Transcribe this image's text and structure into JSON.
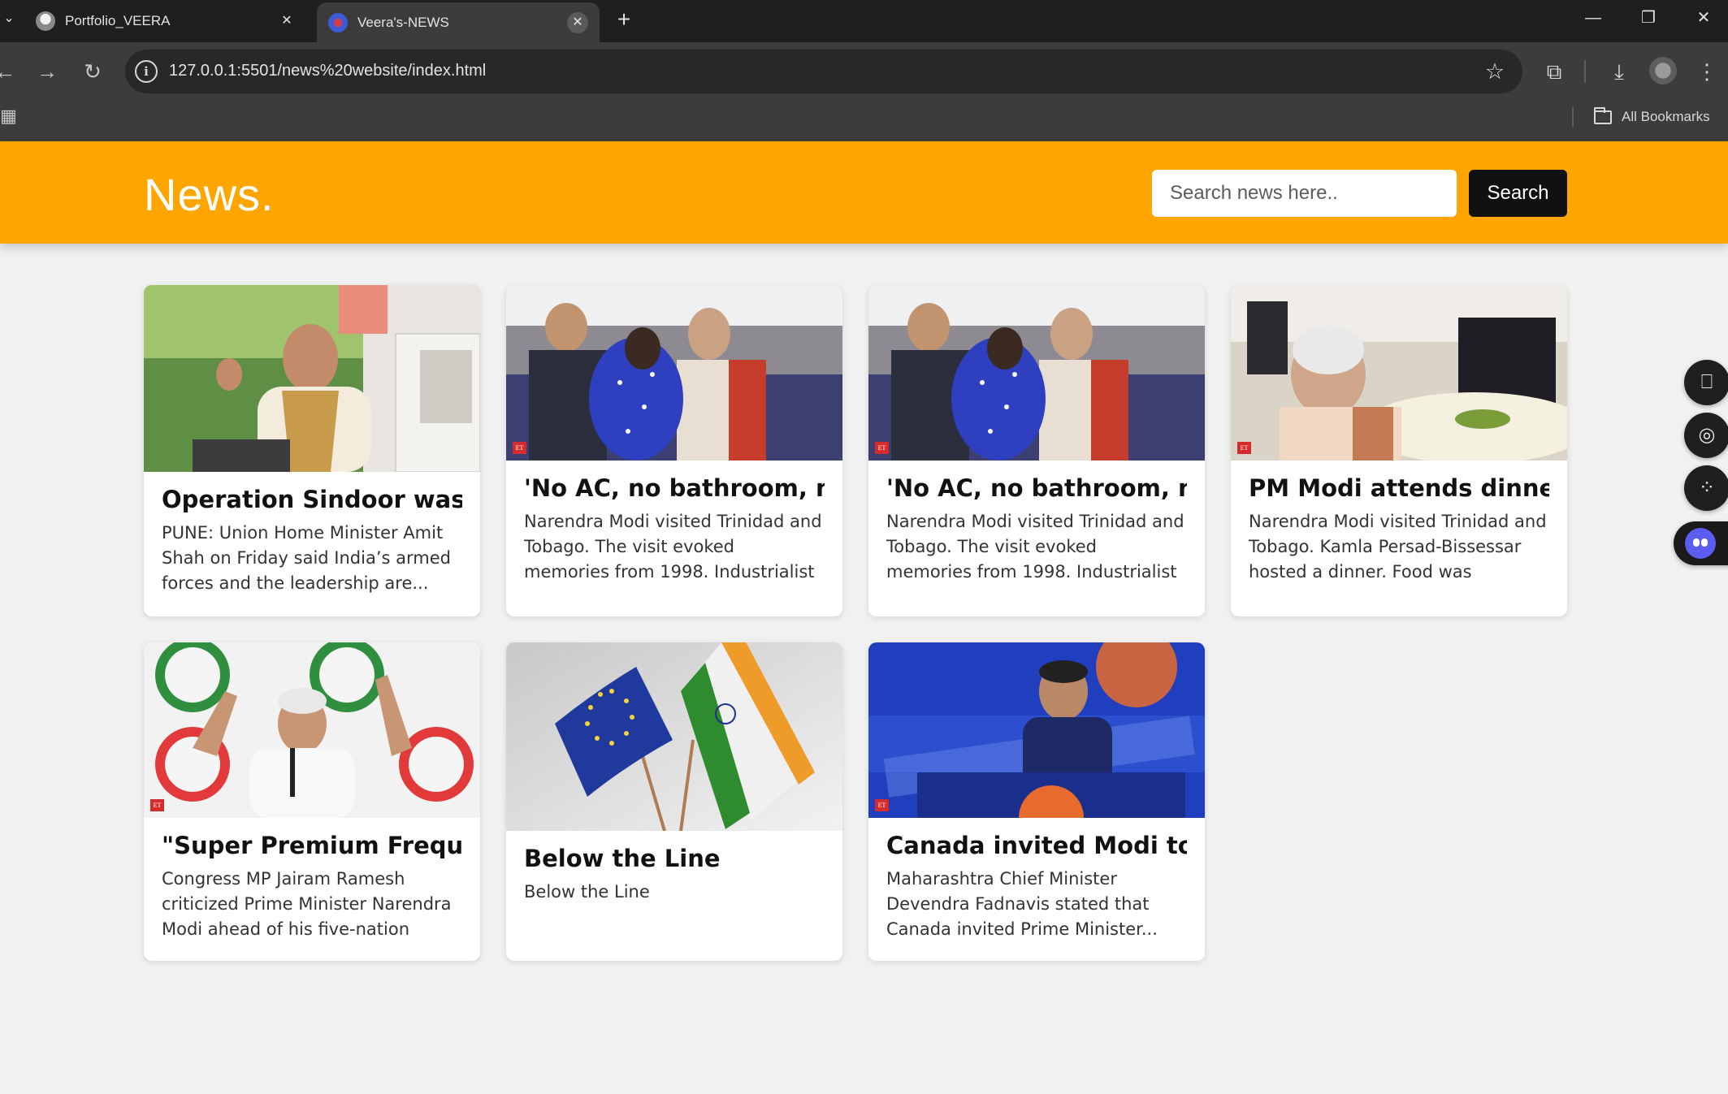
{
  "browser": {
    "tabs": [
      {
        "title": "Portfolio_VEERA",
        "close": "✕"
      },
      {
        "title": "Veera's-NEWS",
        "close": "✕"
      }
    ],
    "new_tab": "+",
    "window_controls": {
      "minimize": "—",
      "restore": "❐",
      "close": "✕"
    },
    "nav": {
      "back": "←",
      "forward": "→",
      "reload": "↻"
    },
    "url": "127.0.0.1:5501/news%20website/index.html",
    "bookmarks": {
      "all_bookmarks": "All Bookmarks"
    }
  },
  "header": {
    "logo": "News.",
    "search_placeholder": "Search news here..",
    "search_button": "Search"
  },
  "cards": [
    {
      "title": "Operation Sindoor was ‘f...",
      "description": "PUNE: Union Home Minister Amit Shah on Friday said India’s armed forces and the leadership are...",
      "image": "Amit Shah speaking at podium"
    },
    {
      "title": "'No AC, no bathroom, no...",
      "description": "Narendra Modi visited Trinidad and Tobago. The visit evoked memories from 1998. Industrialist ML Mittal...",
      "image": "Narendra Modi greeting woman in blue saree"
    },
    {
      "title": "'No AC, no bathroom, no...",
      "description": "Narendra Modi visited Trinidad and Tobago. The visit evoked memories from 1998. Industrialist ML Mittal...",
      "image": "Narendra Modi greeting woman in blue saree"
    },
    {
      "title": "PM Modi attends dinner ...",
      "description": "Narendra Modi visited Trinidad and Tobago. Kamla Persad-Bissessar hosted a dinner. Food was served...",
      "image": "Narendra Modi at dinner table"
    },
    {
      "title": "\"Super Premium Frequen...",
      "description": "Congress MP Jairam Ramesh criticized Prime Minister Narendra Modi ahead of his five-nation tour,...",
      "image": "Jairam Ramesh gesturing in front of Congress symbols"
    },
    {
      "title": "Below the Line",
      "description": "Below the Line",
      "image": "EU and India flags"
    },
    {
      "title": "Canada invited Modi to ...",
      "description": "Maharashtra Chief Minister Devendra Fadnavis stated that Canada invited Prime Minister...",
      "image": "Devendra Fadnavis at World Hindu Economic Forum podium"
    }
  ],
  "badge_label": "ET",
  "colors": {
    "header": "#ffa500",
    "search_button": "#111111",
    "page_bg": "#f1f1f1"
  }
}
